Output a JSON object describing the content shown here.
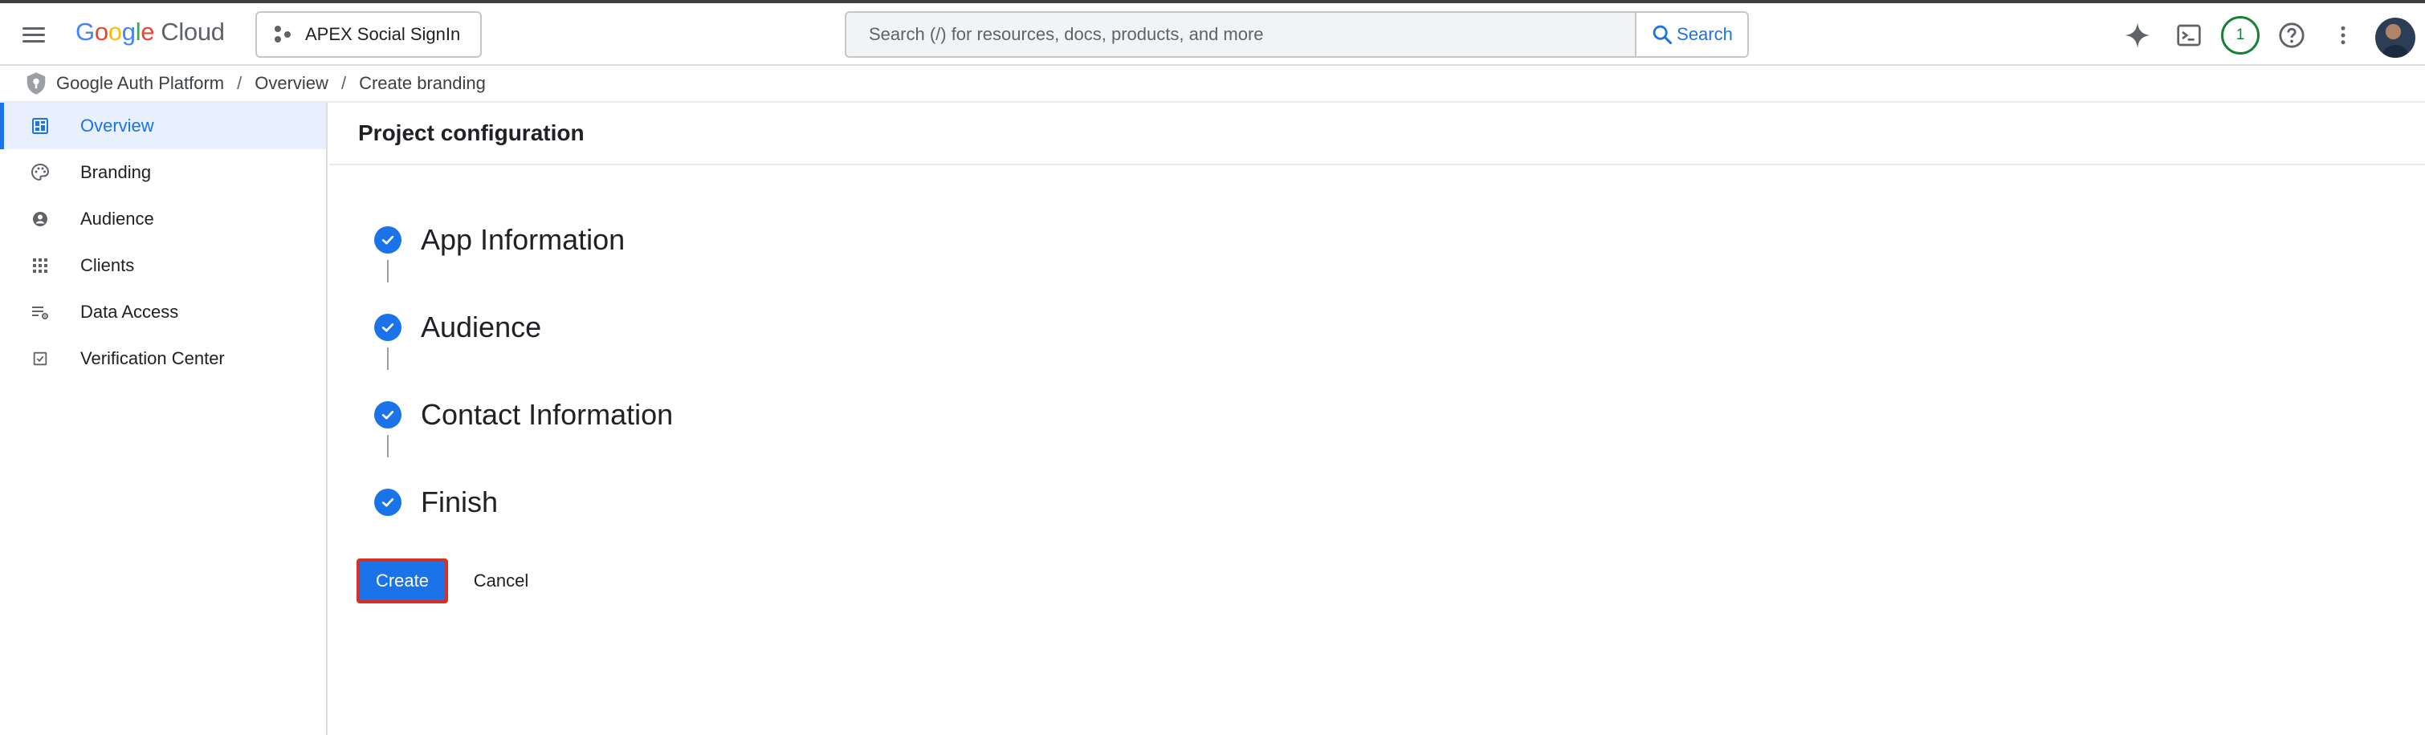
{
  "header": {
    "logo": {
      "g1": "G",
      "g2": "o",
      "g3": "o",
      "g4": "g",
      "g5": "l",
      "g6": "e",
      "product": "Cloud"
    },
    "project_name": "APEX Social SignIn",
    "search": {
      "placeholder": "Search (/) for resources, docs, products, and more",
      "button_label": "Search"
    },
    "notification_count": "1",
    "icons": [
      "menu-icon",
      "project-dots-icon",
      "search-icon",
      "gemini-spark-icon",
      "cloud-shell-icon",
      "help-icon",
      "more-vert-icon",
      "account-avatar"
    ]
  },
  "breadcrumb": {
    "items": [
      "Google Auth Platform",
      "Overview",
      "Create branding"
    ],
    "separator": "/"
  },
  "sidebar": {
    "items": [
      {
        "label": "Overview",
        "icon": "dashboard-icon",
        "active": true
      },
      {
        "label": "Branding",
        "icon": "palette-icon",
        "active": false
      },
      {
        "label": "Audience",
        "icon": "account-circle-icon",
        "active": false
      },
      {
        "label": "Clients",
        "icon": "apps-grid-icon",
        "active": false
      },
      {
        "label": "Data Access",
        "icon": "list-settings-icon",
        "active": false
      },
      {
        "label": "Verification Center",
        "icon": "checkbox-icon",
        "active": false
      }
    ]
  },
  "main": {
    "title": "Project configuration",
    "steps": [
      {
        "label": "App Information",
        "status": "complete"
      },
      {
        "label": "Audience",
        "status": "complete"
      },
      {
        "label": "Contact Information",
        "status": "complete"
      },
      {
        "label": "Finish",
        "status": "complete"
      }
    ],
    "create_label": "Create",
    "cancel_label": "Cancel"
  },
  "colors": {
    "accent": "#1a73e8",
    "active_nav_bg": "#e8f0fe",
    "highlight_border": "#d93025",
    "notification_green": "#188038"
  }
}
